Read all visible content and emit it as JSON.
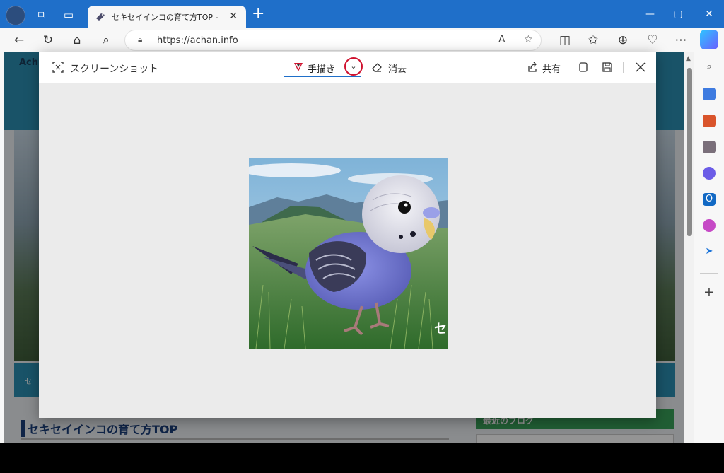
{
  "browser": {
    "tab_title": "セキセイインコの育て方TOP - セキセイ",
    "url": "https://achan.info"
  },
  "webpage": {
    "site_title_partial": "Ach",
    "nav_bar_text": "セ",
    "page_heading": "セキセイインコの育て方TOP",
    "sidebar_heading": "最近のブログ"
  },
  "screenshot_tool": {
    "title": "スクリーンショット",
    "draw_label": "手描き",
    "erase_label": "消去",
    "share_label": "共有",
    "image_caption_partial": "セ"
  },
  "colors": {
    "titlebar": "#1f6fc9",
    "highlight_circle": "#d0122f",
    "active_underline": "#1f6fc9"
  }
}
